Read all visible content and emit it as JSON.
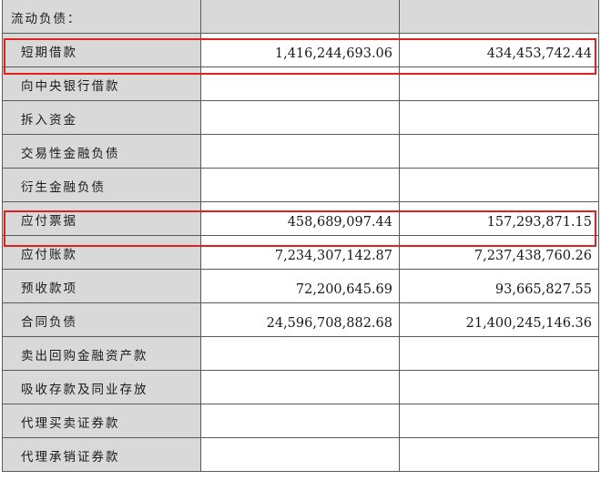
{
  "table": {
    "rows": [
      {
        "label": "流动负债：",
        "current": "",
        "previous": ""
      },
      {
        "label": "短期借款",
        "current": "1,416,244,693.06",
        "previous": "434,453,742.44"
      },
      {
        "label": "向中央银行借款",
        "current": "",
        "previous": ""
      },
      {
        "label": "拆入资金",
        "current": "",
        "previous": ""
      },
      {
        "label": "交易性金融负债",
        "current": "",
        "previous": ""
      },
      {
        "label": "衍生金融负债",
        "current": "",
        "previous": ""
      },
      {
        "label": "应付票据",
        "current": "458,689,097.44",
        "previous": "157,293,871.15"
      },
      {
        "label": "应付账款",
        "current": "7,234,307,142.87",
        "previous": "7,237,438,760.26"
      },
      {
        "label": "预收款项",
        "current": "72,200,645.69",
        "previous": "93,665,827.55"
      },
      {
        "label": "合同负债",
        "current": "24,596,708,882.68",
        "previous": "21,400,245,146.36"
      },
      {
        "label": "卖出回购金融资产款",
        "current": "",
        "previous": ""
      },
      {
        "label": "吸收存款及同业存放",
        "current": "",
        "previous": ""
      },
      {
        "label": "代理买卖证券款",
        "current": "",
        "previous": ""
      },
      {
        "label": "代理承销证券款",
        "current": "",
        "previous": ""
      }
    ]
  },
  "highlight_color": "#e0201c",
  "header_fill_color": "#d9d9d9"
}
